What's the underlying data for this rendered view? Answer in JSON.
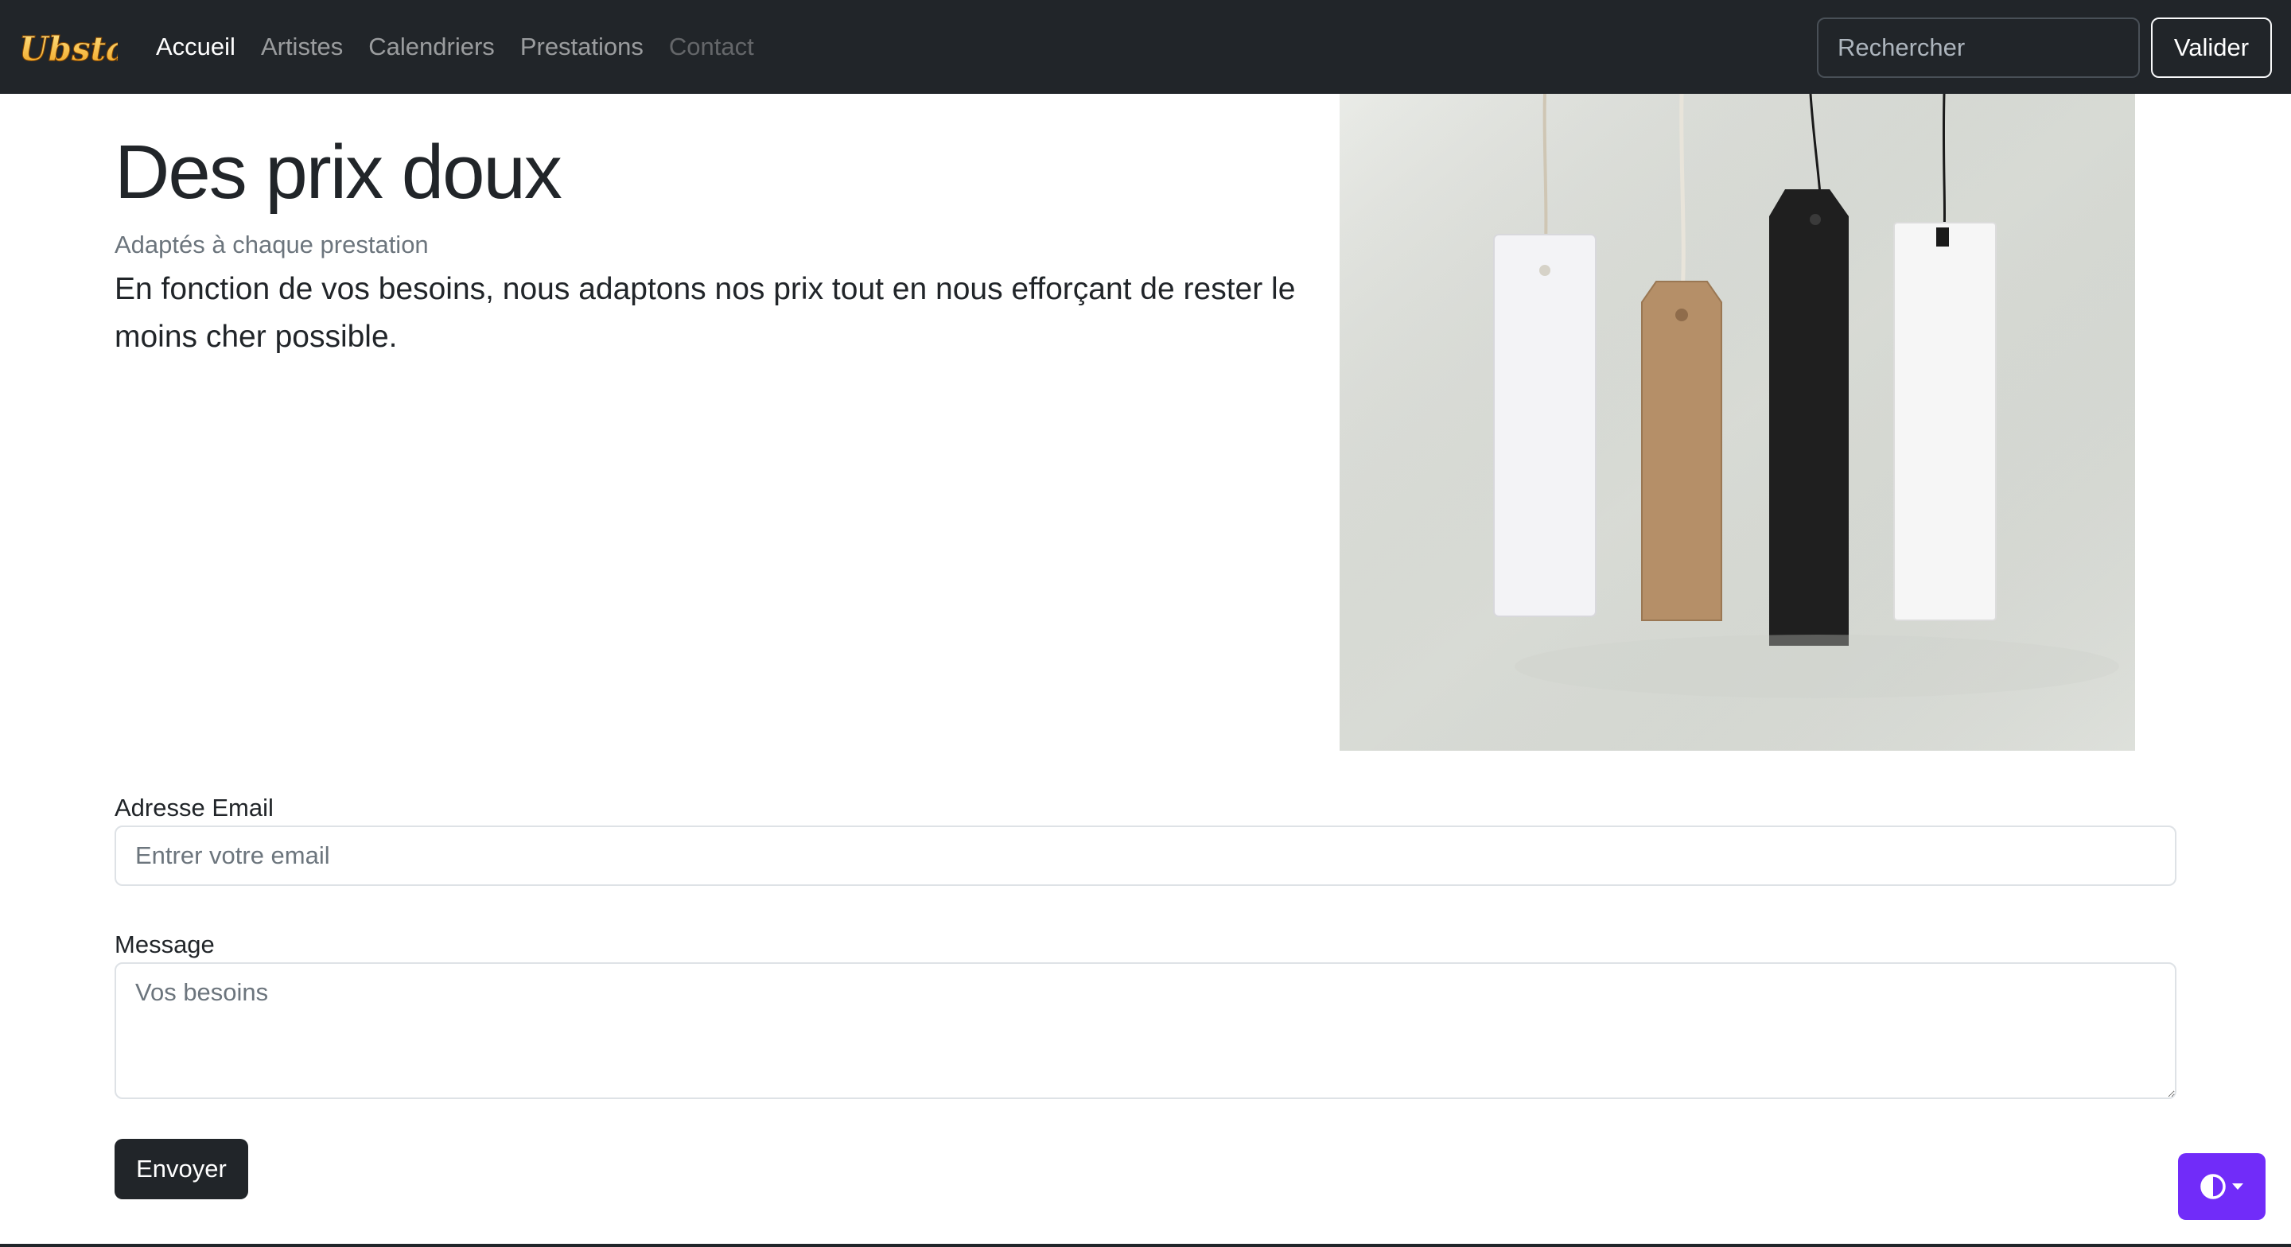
{
  "navbar": {
    "brand": "Ubstar",
    "links": [
      {
        "label": "Accueil",
        "state": "active"
      },
      {
        "label": "Artistes",
        "state": "normal"
      },
      {
        "label": "Calendriers",
        "state": "normal"
      },
      {
        "label": "Prestations",
        "state": "normal"
      },
      {
        "label": "Contact",
        "state": "disabled"
      }
    ],
    "search": {
      "placeholder": "Rechercher",
      "button_label": "Valider"
    }
  },
  "hero": {
    "title": "Des prix doux",
    "subtitle": "Adaptés à chaque prestation",
    "lead": "En fonction de vos besoins, nous adaptons nos prix tout en nous efforçant de rester le moins cher possible."
  },
  "form": {
    "email_label": "Adresse Email",
    "email_placeholder": "Entrer votre email",
    "message_label": "Message",
    "message_placeholder": "Vos besoins",
    "submit_label": "Envoyer"
  },
  "theme_toggle": {
    "icon": "contrast-icon",
    "caret": "caret-down-icon"
  },
  "colors": {
    "navbar_bg": "#212529",
    "accent": "#712cf9",
    "primary_button": "#212529"
  }
}
